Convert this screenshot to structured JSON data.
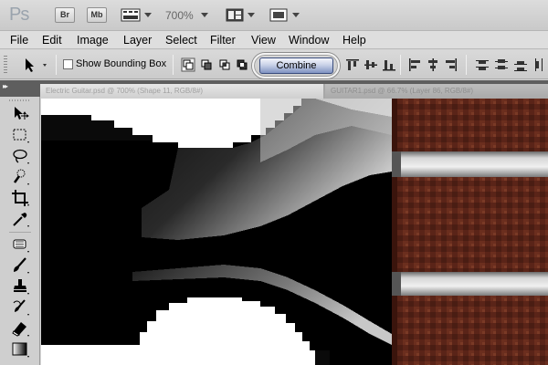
{
  "app": {
    "logo": "Ps",
    "bridge_label": "Br",
    "minibridge_label": "Mb",
    "zoom_level": "700%"
  },
  "menu": [
    "File",
    "Edit",
    "Image",
    "Layer",
    "Select",
    "Filter",
    "View",
    "Window",
    "Help"
  ],
  "options": {
    "show_bounding_box_label": "Show Bounding Box",
    "show_bounding_box_checked": false,
    "combine_label": "Combine"
  },
  "documents": {
    "tab1_title": "Electric Guitar.psd @ 700% (Shape 11, RGB/8#)",
    "tab2_title": "GUITAR1.psd @ 66.7% (Layer 86, RGB/8#)"
  },
  "colors": {
    "combine_button": "#9aa8cf",
    "wood": "#5a2418",
    "metal": "#c4c4c4"
  },
  "tools": [
    "move-tool-icon",
    "marquee-tool-icon",
    "lasso-tool-icon",
    "quick-select-tool-icon",
    "crop-tool-icon",
    "eyedropper-tool-icon",
    "healing-brush-tool-icon",
    "brush-tool-icon",
    "clone-stamp-tool-icon",
    "history-brush-tool-icon",
    "eraser-tool-icon",
    "gradient-tool-icon"
  ]
}
